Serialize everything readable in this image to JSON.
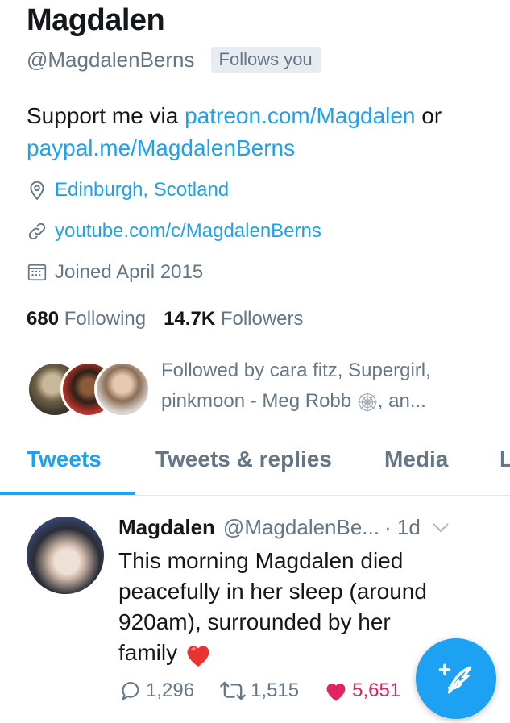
{
  "profile": {
    "name": "Magdalen",
    "handle": "@MagdalenBerns",
    "follows_badge": "Follows you",
    "bio": {
      "text1": "Support me via ",
      "link1": "patreon.com/Magdalen",
      "text2": " or ",
      "link2": "paypal.me/MagdalenBerns"
    },
    "location": "Edinburgh, Scotland",
    "website": "youtube.com/c/MagdalenBerns",
    "joined": "Joined April 2015",
    "following_count": "680",
    "following_label": "Following",
    "followers_count": "14.7K",
    "followers_label": "Followers",
    "followed_by_line1": "Followed by cara fitz, Supergirl,",
    "followed_by_line2a": "pinkmoon - Meg Robb ",
    "followed_by_line2b": ", an..."
  },
  "tabs": [
    {
      "label": "Tweets",
      "active": true
    },
    {
      "label": "Tweets & replies",
      "active": false
    },
    {
      "label": "Media",
      "active": false
    },
    {
      "label": "L",
      "active": false
    }
  ],
  "tweet": {
    "name": "Magdalen",
    "handle": "@MagdalenBe...",
    "time": "· 1d",
    "text_lines": [
      "This morning Magdalen died",
      "peacefully in her sleep  (around",
      "920am), surrounded by her",
      "family"
    ],
    "replies": "1,296",
    "retweets": "1,515",
    "likes": "5,651"
  },
  "icons": {
    "location": "location-pin-icon",
    "link": "link-icon",
    "calendar": "calendar-icon",
    "reply": "reply-icon",
    "retweet": "retweet-icon",
    "like": "heart-icon",
    "compose": "compose-tweet-icon"
  },
  "colors": {
    "accent": "#1da1f2",
    "muted": "#657786",
    "like": "#e0245e"
  }
}
